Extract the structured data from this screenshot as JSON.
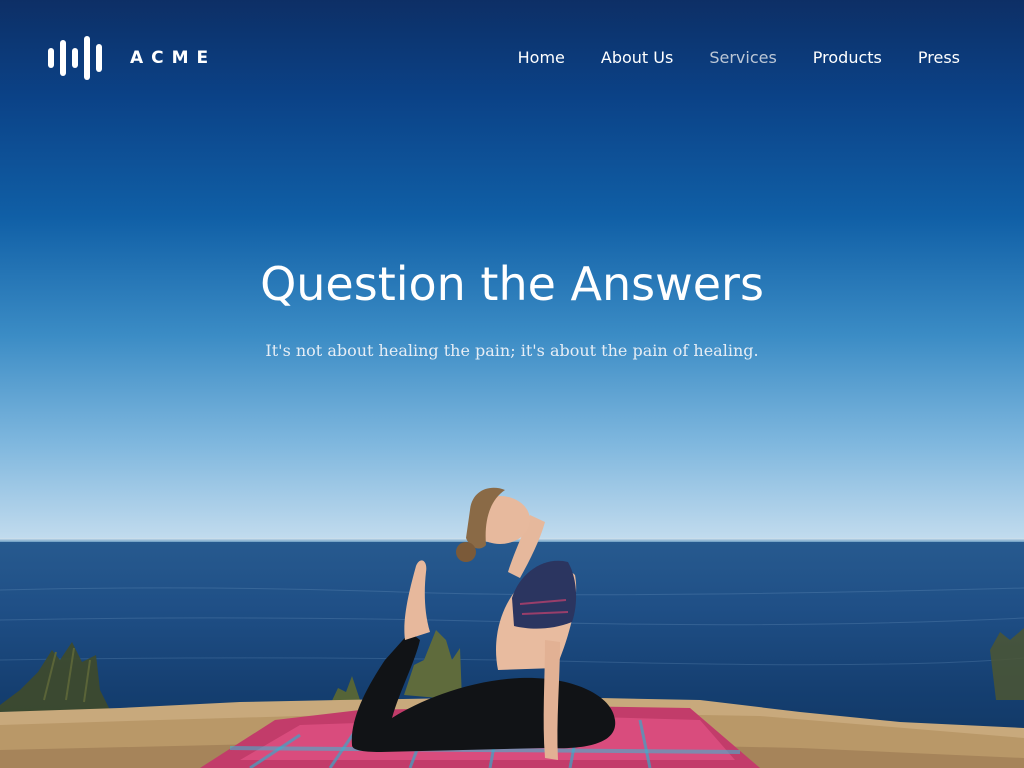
{
  "brand": {
    "logo_icon": "sound-wave-bars-icon",
    "name": "ACME"
  },
  "nav": {
    "items": [
      {
        "label": "Home",
        "active": false
      },
      {
        "label": "About Us",
        "active": false
      },
      {
        "label": "Services",
        "active": true
      },
      {
        "label": "Products",
        "active": false
      },
      {
        "label": "Press",
        "active": false
      }
    ]
  },
  "hero": {
    "title": "Question the Answers",
    "subtitle": "It's not about healing the pain; it's about the pain of healing."
  },
  "colors": {
    "text": "#ffffff",
    "nav_active": "#bcc7d6",
    "sky_top": "#0d2f66",
    "sea": "#1f4f86"
  }
}
